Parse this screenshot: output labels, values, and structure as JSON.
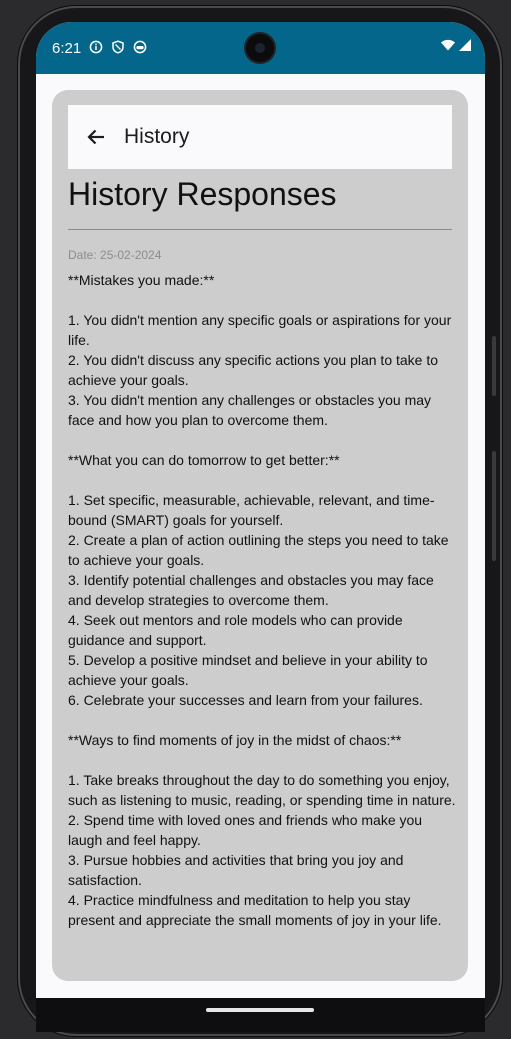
{
  "status_bar": {
    "time": "6:21",
    "left_icons": [
      "info-icon",
      "shield-icon",
      "face-icon"
    ],
    "right_icons": [
      "wifi-icon",
      "signal-icon"
    ],
    "color": "#03668a"
  },
  "toolbar": {
    "back_icon": "arrow-left-icon",
    "title": "History"
  },
  "main": {
    "heading": "History Responses",
    "date": "Date: 25-02-2024",
    "response": "**Mistakes you made:**\n\n1. You didn't mention any specific goals or aspirations for your life.\n2. You didn't discuss any specific actions you plan to take to achieve your goals.\n3. You didn't mention any challenges or obstacles you may face and how you plan to overcome them.\n\n**What you can do tomorrow to get better:**\n\n1. Set specific, measurable, achievable, relevant, and time-bound (SMART) goals for yourself.\n2. Create a plan of action outlining the steps you need to take to achieve your goals.\n3. Identify potential challenges and obstacles you may face and develop strategies to overcome them.\n4. Seek out mentors and role models who can provide guidance and support.\n5. Develop a positive mindset and believe in your ability to achieve your goals.\n6. Celebrate your successes and learn from your failures.\n\n**Ways to find moments of joy in the midst of chaos:**\n\n1. Take breaks throughout the day to do something you enjoy, such as listening to music, reading, or spending time in nature.\n2. Spend time with loved ones and friends who make you laugh and feel happy.\n3. Pursue hobbies and activities that bring you joy and satisfaction.\n4. Practice mindfulness and meditation to help you stay present and appreciate the small moments of joy in your life."
  }
}
